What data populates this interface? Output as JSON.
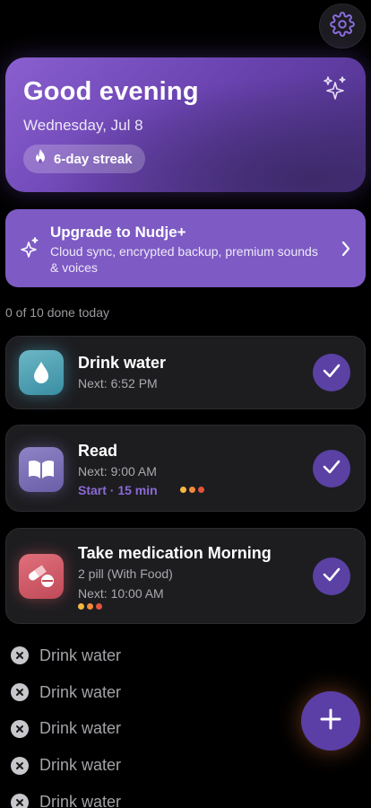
{
  "header": {
    "settings_icon": "gear-icon"
  },
  "hero": {
    "greeting": "Good evening",
    "date": "Wednesday, Jul 8",
    "streak_label": "6-day streak",
    "streak_icon": "flame-icon",
    "sparkle_icon": "sparkles-icon",
    "gradient_colors": [
      "#8a5fcf",
      "#4b2f86"
    ]
  },
  "upgrade": {
    "title": "Upgrade to Nudje+",
    "subtitle": "Cloud sync, encrypted backup, premium sounds & voices",
    "icon": "sparkles-icon",
    "chevron": "chevron-right-icon",
    "color": "#7d5ac4"
  },
  "progress": {
    "label": "0 of 10 done today",
    "done": 0,
    "total": 10
  },
  "tasks": [
    {
      "title": "Drink water",
      "icon": "water-drop-icon",
      "next": "Next: 6:52 PM",
      "color": "#4a9fb2"
    },
    {
      "title": "Read",
      "icon": "open-book-icon",
      "next": "Next: 9:00 AM",
      "action": "Start · 15 min",
      "color": "#7b6fb8"
    },
    {
      "title": "Take medication Morning",
      "icon": "pills-icon",
      "dose": "2 pill (With Food)",
      "next": "Next: 10:00 AM",
      "color": "#d45c69"
    }
  ],
  "skipped": [
    {
      "label": "Drink water"
    },
    {
      "label": "Drink water"
    },
    {
      "label": "Drink water"
    },
    {
      "label": "Drink water"
    },
    {
      "label": "Drink water"
    }
  ],
  "fab": {
    "icon": "plus-icon",
    "color": "#5b3ea6"
  },
  "colors": {
    "accent": "#5a41a3",
    "background": "#000000",
    "card": "#1d1d20"
  }
}
